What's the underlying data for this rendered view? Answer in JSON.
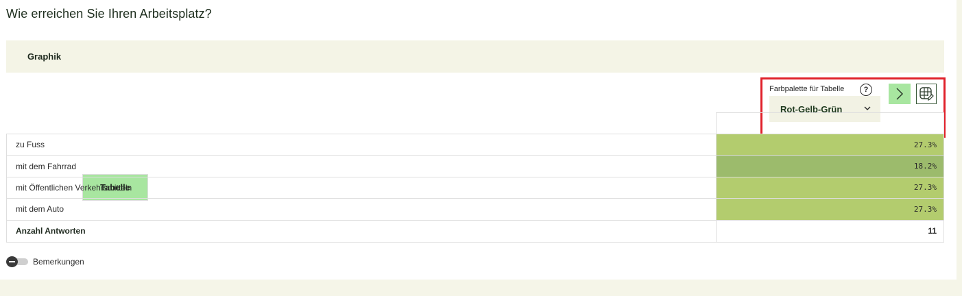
{
  "page": {
    "title": "Wie erreichen Sie Ihren Arbeitsplatz?"
  },
  "tabs": [
    {
      "label": "Graphik",
      "active": false
    },
    {
      "label": "Tabelle",
      "active": true
    }
  ],
  "palette": {
    "label": "Farbpalette für Tabelle",
    "help": "?",
    "selected": "Rot-Gelb-Grün"
  },
  "table": {
    "rows": [
      {
        "label": "zu Fuss",
        "value": "27.3%",
        "color": "#b3cc6e"
      },
      {
        "label": "mit dem Fahrrad",
        "value": "18.2%",
        "color": "#9cbb6c"
      },
      {
        "label": "mit Öffentlichen Verkehrsmitteln",
        "value": "27.3%",
        "color": "#b3cc6e"
      },
      {
        "label": "mit dem Auto",
        "value": "27.3%",
        "color": "#b3cc6e"
      }
    ],
    "total": {
      "label": "Anzahl Antworten",
      "value": "11"
    }
  },
  "remarks": {
    "label": "Bemerkungen",
    "enabled": false
  },
  "colors": {
    "accent": "#a8e6a0",
    "highlight_border": "#e0202a"
  },
  "icons": {
    "help": "help-icon",
    "next": "chevron-right-icon",
    "edit_table": "table-edit-icon",
    "dropdown": "chevron-down-icon"
  }
}
